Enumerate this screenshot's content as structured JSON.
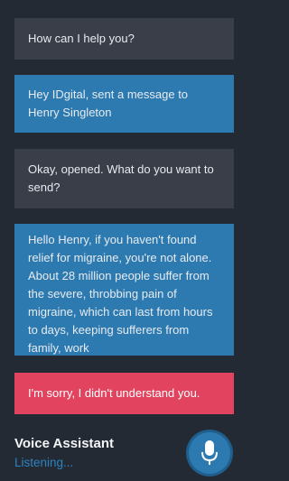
{
  "conversation": [
    {
      "role": "assistant",
      "text": "How can I help you?"
    },
    {
      "role": "user",
      "text": "Hey IDgital, sent a message to Henry Singleton"
    },
    {
      "role": "assistant",
      "text": "Okay, opened. What do you want to send?"
    },
    {
      "role": "user",
      "text": "Hello Henry, if you haven't found relief for migraine, you're not alone. About 28 million people suffer from the severe, throbbing pain of migraine, which can last from hours to days, keeping sufferers from family, work"
    },
    {
      "role": "error",
      "text": "I'm sorry, I didn't understand you."
    }
  ],
  "footer": {
    "title": "Voice Assistant",
    "status": "Listening..."
  },
  "mic_button": {
    "icon": "microphone-icon"
  },
  "colors": {
    "background": "#242a33",
    "assistant_bubble": "#3a3e48",
    "user_bubble": "#2d7ab1",
    "error_bubble": "#e2445f",
    "accent": "#2d83c2"
  }
}
